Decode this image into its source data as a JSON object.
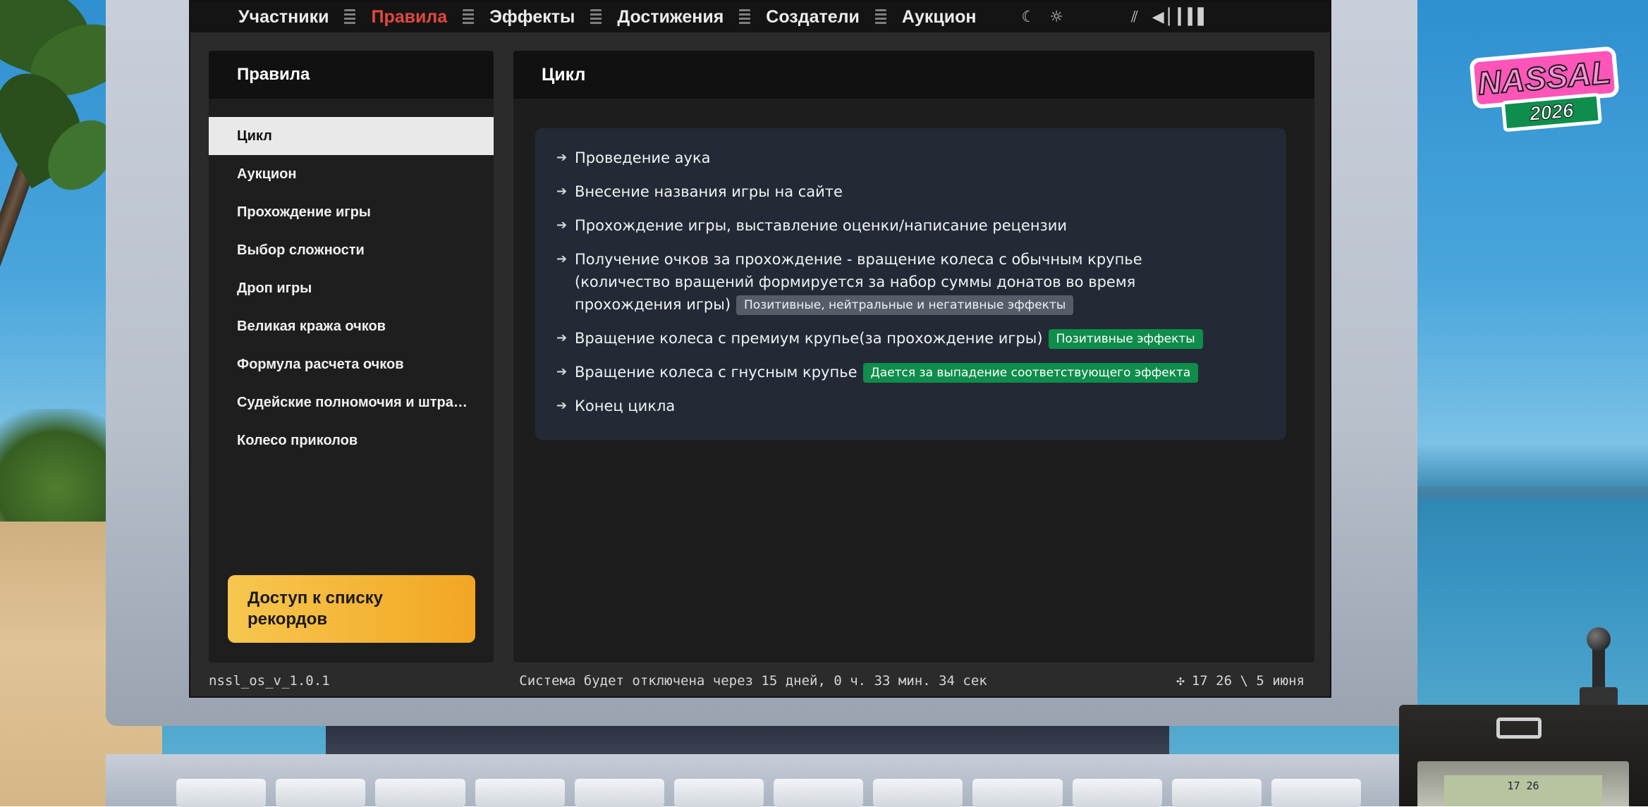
{
  "nav": {
    "items": [
      {
        "label": "Участники",
        "active": false
      },
      {
        "label": "Правила",
        "active": true
      },
      {
        "label": "Эффекты",
        "active": false
      },
      {
        "label": "Достижения",
        "active": false
      },
      {
        "label": "Создатели",
        "active": false
      },
      {
        "label": "Аукцион",
        "active": false
      }
    ],
    "icons": [
      "moon-icon",
      "sun-icon",
      "signal-icon",
      "volume-icon",
      "volume-level-icon"
    ]
  },
  "sidebar": {
    "title": "Правила",
    "items": [
      {
        "label": "Цикл",
        "active": true
      },
      {
        "label": "Аукцион",
        "active": false
      },
      {
        "label": "Прохождение игры",
        "active": false
      },
      {
        "label": "Выбор сложности",
        "active": false
      },
      {
        "label": "Дроп игры",
        "active": false
      },
      {
        "label": "Великая кража очков",
        "active": false
      },
      {
        "label": "Формула расчета очков",
        "active": false
      },
      {
        "label": "Судейские полномочия и штрафы",
        "active": false
      },
      {
        "label": "Колесо приколов",
        "active": false
      }
    ],
    "cta": "Доступ к списку рекордов"
  },
  "main": {
    "title": "Цикл",
    "steps": [
      {
        "text": "Проведение аука",
        "badge": null,
        "badge_color": null
      },
      {
        "text": "Внесение названия игры на сайте",
        "badge": null,
        "badge_color": null
      },
      {
        "text": "Прохождение игры, выставление оценки/написание рецензии",
        "badge": null,
        "badge_color": null
      },
      {
        "text": "Получение очков за прохождение - вращение колеса с обычным крупье (количество вращений формируется за набор суммы донатов во время прохождения игры)",
        "badge": "Позитивные, нейтральные и негативные эффекты",
        "badge_color": "gray"
      },
      {
        "text": "Вращение колеса с премиум крупье(за прохождение игры)",
        "badge": "Позитивные эффекты",
        "badge_color": "green"
      },
      {
        "text": "Вращение колеса с гнусным крупье",
        "badge": "Дается за выпадение соответствующего эффекта",
        "badge_color": "green"
      },
      {
        "text": "Конец цикла",
        "badge": null,
        "badge_color": null
      }
    ]
  },
  "status": {
    "version": "nssl_os_v_1.0.1",
    "countdown": "Система будет отключена через 15 дней, 0 ч. 33 мин. 34 сек",
    "datetime": "17 26 \\ 5 июня"
  },
  "logo": {
    "name": "NASSAL",
    "year": "2026"
  },
  "pager": {
    "time": "17 26"
  },
  "colors": {
    "accent_red": "#e3483f",
    "cta_yellow": "#f5b83a",
    "badge_green": "#0f8d4b",
    "badge_gray": "#565d69"
  }
}
